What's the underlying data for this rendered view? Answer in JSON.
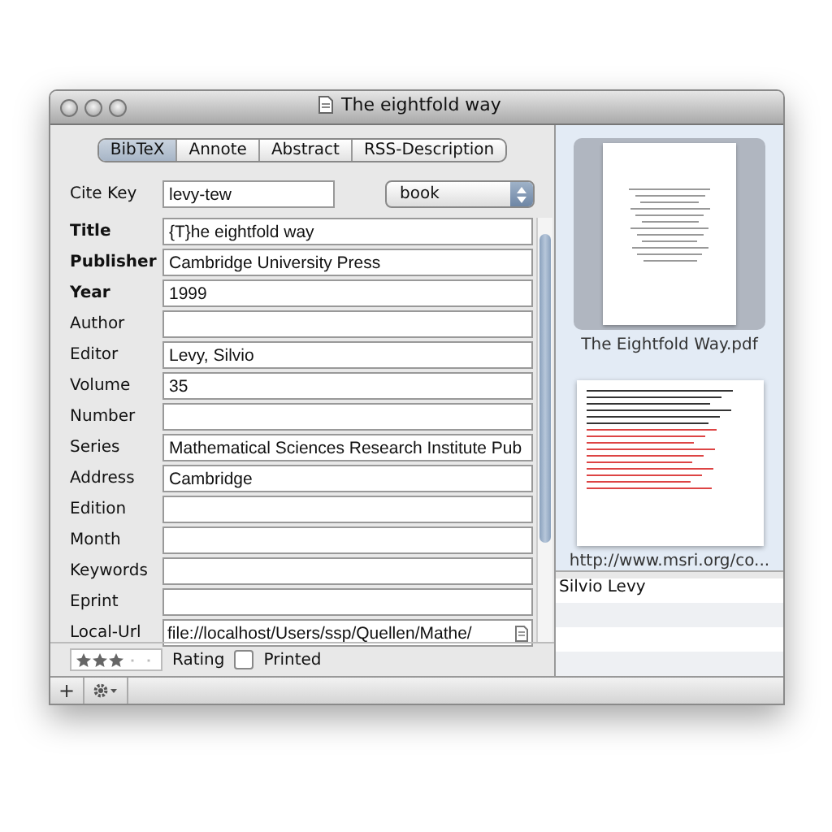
{
  "window": {
    "title": "The eightfold way"
  },
  "tabs": [
    {
      "label": "BibTeX",
      "selected": true
    },
    {
      "label": "Annote",
      "selected": false
    },
    {
      "label": "Abstract",
      "selected": false
    },
    {
      "label": "RSS-Description",
      "selected": false
    }
  ],
  "cite_key": {
    "label": "Cite Key",
    "value": "levy-tew"
  },
  "type_popup": {
    "value": "book"
  },
  "fields": [
    {
      "label": "Title",
      "value": "{T}he eightfold way",
      "required": true
    },
    {
      "label": "Publisher",
      "value": "Cambridge University Press",
      "required": true
    },
    {
      "label": "Year",
      "value": "1999",
      "required": true
    },
    {
      "label": "Author",
      "required": false
    },
    {
      "label": "Editor",
      "value": "Levy, Silvio",
      "required": false
    },
    {
      "label": "Volume",
      "value": "35",
      "required": false
    },
    {
      "label": "Number",
      "required": false
    },
    {
      "label": "Series",
      "value": "Mathematical Sciences Research Institute Pub",
      "required": false
    },
    {
      "label": "Address",
      "value": "Cambridge",
      "required": false
    },
    {
      "label": "Edition",
      "required": false
    },
    {
      "label": "Month",
      "required": false
    },
    {
      "label": "Keywords",
      "required": false
    },
    {
      "label": "Eprint",
      "required": false
    },
    {
      "label": "Local-Url",
      "value": "file://localhost/Users/ssp/Quellen/Mathe/",
      "required": false,
      "kind": "file"
    }
  ],
  "rating": {
    "label": "Rating",
    "stars": 3
  },
  "printed": {
    "label": "Printed",
    "checked": false
  },
  "bottom_bar": {
    "add": "+"
  },
  "files": [
    {
      "name": "The Eightfold Way.pdf",
      "kind": "pdf"
    },
    {
      "name": "http://www.msri.org/co...",
      "kind": "web"
    }
  ],
  "authors": [
    "Silvio Levy"
  ]
}
